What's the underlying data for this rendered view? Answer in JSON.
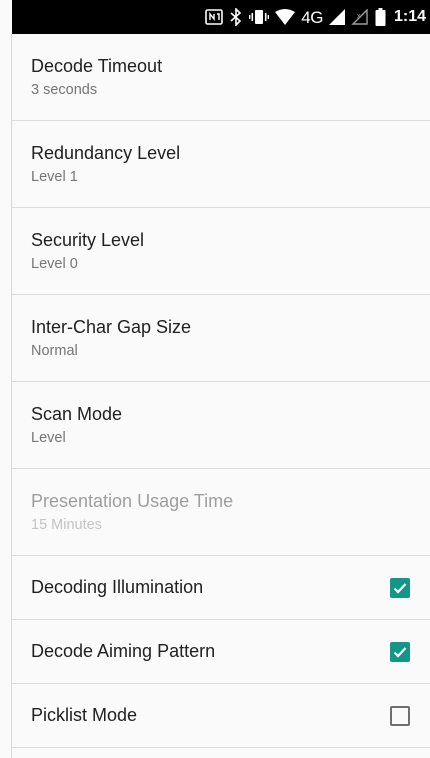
{
  "status_bar": {
    "icons": [
      "nfc-icon",
      "bluetooth-icon",
      "vibrate-icon",
      "wifi-icon"
    ],
    "network_label": "4G",
    "time": "1:14"
  },
  "settings": [
    {
      "title": "Decode Timeout",
      "summary": "3 seconds",
      "enabled": true
    },
    {
      "title": "Redundancy Level",
      "summary": "Level 1",
      "enabled": true
    },
    {
      "title": "Security Level",
      "summary": "Level 0",
      "enabled": true
    },
    {
      "title": "Inter-Char Gap Size",
      "summary": "Normal",
      "enabled": true
    },
    {
      "title": "Scan Mode",
      "summary": "Level",
      "enabled": true
    },
    {
      "title": "Presentation Usage Time",
      "summary": "15 Minutes",
      "enabled": false
    }
  ],
  "toggles": [
    {
      "title": "Decoding Illumination",
      "checked": true
    },
    {
      "title": "Decode Aiming Pattern",
      "checked": true
    },
    {
      "title": "Picklist Mode",
      "checked": false
    }
  ],
  "colors": {
    "accent": "#129688",
    "title_text": "#212121",
    "summary_text": "#757575",
    "disabled_title": "#9e9e9e",
    "disabled_summary": "#c4c4c4"
  }
}
